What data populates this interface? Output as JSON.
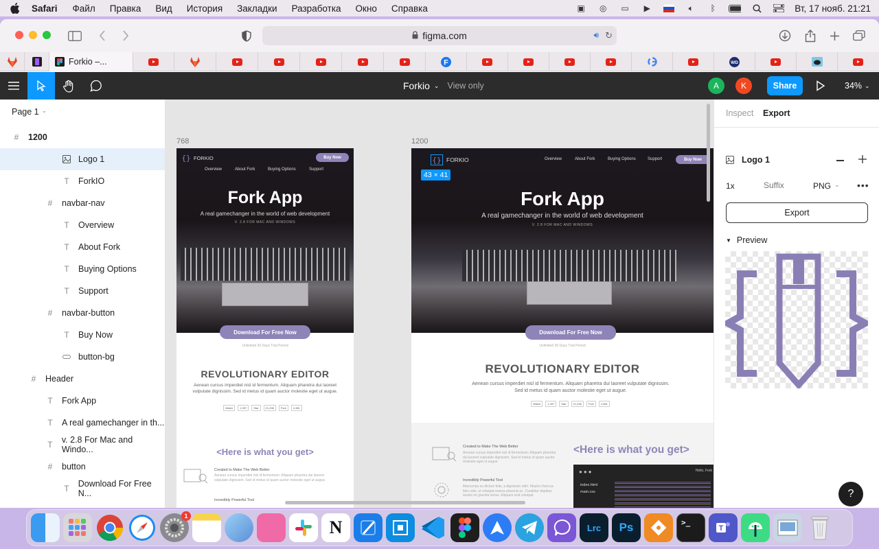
{
  "menubar": {
    "app": "Safari",
    "items": [
      "Файл",
      "Правка",
      "Вид",
      "История",
      "Закладки",
      "Разработка",
      "Окно",
      "Справка"
    ],
    "clock": "Вт, 17 нояб. 21:21"
  },
  "browser": {
    "url": "figma.com",
    "active_tab": "Forkio –..."
  },
  "figma": {
    "file_name": "Forkio",
    "view_mode": "View only",
    "avatars": [
      "A",
      "K"
    ],
    "share_label": "Share",
    "zoom": "34%"
  },
  "layers": {
    "page": "Page 1",
    "items": [
      {
        "name": "1200",
        "icon": "#"
      },
      {
        "name": "Logo 1",
        "icon": "img"
      },
      {
        "name": "ForkIO",
        "icon": "T"
      },
      {
        "name": "navbar-nav",
        "icon": "#"
      },
      {
        "name": "Overview",
        "icon": "T"
      },
      {
        "name": "About Fork",
        "icon": "T"
      },
      {
        "name": "Buying Options",
        "icon": "T"
      },
      {
        "name": "Support",
        "icon": "T"
      },
      {
        "name": "navbar-button",
        "icon": "#"
      },
      {
        "name": "Buy Now",
        "icon": "T"
      },
      {
        "name": "button-bg",
        "icon": "rect"
      },
      {
        "name": "Header",
        "icon": "#"
      },
      {
        "name": "Fork App",
        "icon": "T"
      },
      {
        "name": "A real gamechanger in th...",
        "icon": "T"
      },
      {
        "name": "v. 2.8 For Mac and Windo...",
        "icon": "T"
      },
      {
        "name": "button",
        "icon": "#"
      },
      {
        "name": "Download For Free N...",
        "icon": "T"
      }
    ]
  },
  "canvas": {
    "frame_small_label": "768",
    "frame_large_label": "1200",
    "size_badge": "43 × 41",
    "site": {
      "logo_text": "FORKIO",
      "nav": [
        "Overview",
        "About Fork",
        "Buying Options",
        "Support"
      ],
      "buy_now": "Buy Now",
      "title": "Fork App",
      "subtitle": "A real gamechanger in the world of web development",
      "version": "V. 2.8 FOR MAC AND WINDOWS",
      "download": "Download For Free Now",
      "trial": "Unlimited 30 Days Trial Period",
      "rev_title": "REVOLUTIONARY EDITOR",
      "rev_text_1": "Aenean cursus imperdiet nisl id fermentum. Aliquam pharetra dui laoreet",
      "rev_text_2": "vulputate dignissim. Sed id metus id quam auctor molestie eget ut augue.",
      "rev_text_wide_1": "Aenean cursus imperdiet nisl id fermentum. Aliquam pharetra dui laoreet vulputate dignissim.",
      "rev_text_wide_2": "Sed id metus id quam auctor molestie eget ut augue.",
      "gh_watch": "Watch",
      "gh_watch_n": "1,397",
      "gh_star": "Star",
      "gh_star_n": "21,038",
      "gh_fork": "Fork",
      "gh_fork_n": "4,381",
      "what": "<Here is what you get>",
      "feat1_title": "Created to Make The Web Better",
      "feat1_desc": "Aenean cursus imperdiet nisl id fermentum. Aliquam pharetra dui laoreet vulputate dignissim. Sed id metus id quam auctor molestie eget ut augue.",
      "feat2_title": "Incredibly Powerful Tool",
      "feat2_desc": "Maecenas eu dictum felis, a dignissim nibh. Mauris rhoncus felis odio, ut volutpat massa placerat ac. Curabitur dapibus iaculis mi gravida luctus. Aliquam erat volutpat.",
      "code_files": [
        "index.html",
        "main.css"
      ],
      "code_header": "Hello, Fork"
    }
  },
  "inspector": {
    "tabs": [
      "Inspect",
      "Export"
    ],
    "layer_name": "Logo 1",
    "scale": "1x",
    "suffix_placeholder": "Suffix",
    "format": "PNG",
    "export_label": "Export",
    "preview_label": "Preview",
    "help": "?"
  },
  "colors": {
    "accent": "#0d99ff",
    "brand_purple": "#8f84b8",
    "logo_purple": "#8a7fb5"
  },
  "dock": {
    "settings_badge": "1",
    "apps": [
      "Finder",
      "Launchpad",
      "Chrome",
      "Safari",
      "System Preferences",
      "Notes",
      "Migration",
      "Sketchbook",
      "Slack",
      "Notion",
      "Xcode",
      "Rider",
      "VS Code",
      "Figma",
      "Send",
      "Telegram",
      "Viber",
      "Lightroom Classic",
      "Photoshop",
      "Git",
      "Terminal",
      "Teams",
      "Android Studio",
      "Preview",
      "Trash"
    ],
    "lrc_label": "Lrc",
    "ps_label": "Ps"
  }
}
